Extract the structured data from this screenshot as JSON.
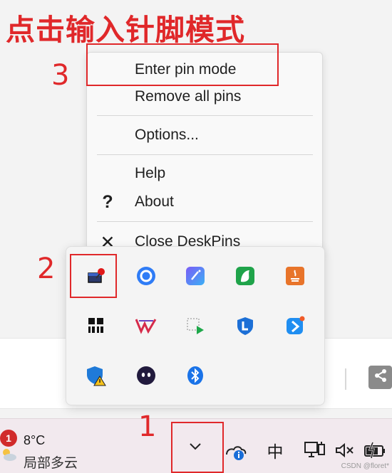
{
  "annotations": {
    "title": "点击输入针脚模式",
    "step1": "1",
    "step2": "2",
    "step3": "3",
    "accent_color": "#e0282a"
  },
  "context_menu": {
    "items": [
      {
        "label": "Enter pin mode",
        "icon": ""
      },
      {
        "label": "Remove all pins",
        "icon": ""
      },
      {
        "label": "Options...",
        "icon": ""
      },
      {
        "label": "Help",
        "icon": ""
      },
      {
        "label": "About",
        "icon": "question-icon",
        "glyph": "?"
      },
      {
        "label": "Close DeskPins",
        "icon": "close-icon",
        "glyph": "✕"
      }
    ]
  },
  "tray_flyout": {
    "icons": [
      "deskpins-icon",
      "circle-app-icon",
      "pen-app-icon",
      "bird-app-icon",
      "java-icon",
      "windows-store-icon",
      "wps-icon",
      "play-app-icon",
      "l-shield-icon",
      "feishu-icon",
      "security-shield-warning-icon",
      "ghost-app-icon",
      "bluetooth-icon"
    ]
  },
  "taskbar": {
    "weather_badge": "1",
    "temperature": "8°C",
    "condition": "局部多云",
    "ime": "中",
    "volume_glyph": "🔈×",
    "watermark": "CSDN @floret*"
  }
}
